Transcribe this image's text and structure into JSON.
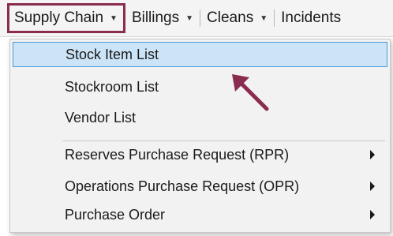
{
  "menubar": {
    "items": [
      {
        "label": "Supply Chain",
        "has_caret": true,
        "active": true
      },
      {
        "label": "Billings",
        "has_caret": true
      },
      {
        "label": "Cleans",
        "has_caret": true
      },
      {
        "label": "Incidents",
        "has_caret": false
      }
    ]
  },
  "dropdown": {
    "items": [
      {
        "label": "Stock Item List",
        "highlighted": true,
        "has_submenu": false
      },
      {
        "label": "Stockroom List",
        "has_submenu": false
      },
      {
        "label": "Vendor List",
        "has_submenu": false
      },
      {
        "label": "Reserves Purchase Request (RPR)",
        "has_submenu": true
      },
      {
        "label": "Operations Purchase Request (OPR)",
        "has_submenu": true
      },
      {
        "label": "Purchase Order",
        "has_submenu": true
      }
    ]
  },
  "colors": {
    "active_outline": "#8a2c4f",
    "highlight_bg": "#cce4f7",
    "highlight_border": "#4a9bd8",
    "annotation_arrow": "#8a2c4f"
  },
  "annotation": {
    "icon": "arrow-pointing-up-left-icon"
  }
}
